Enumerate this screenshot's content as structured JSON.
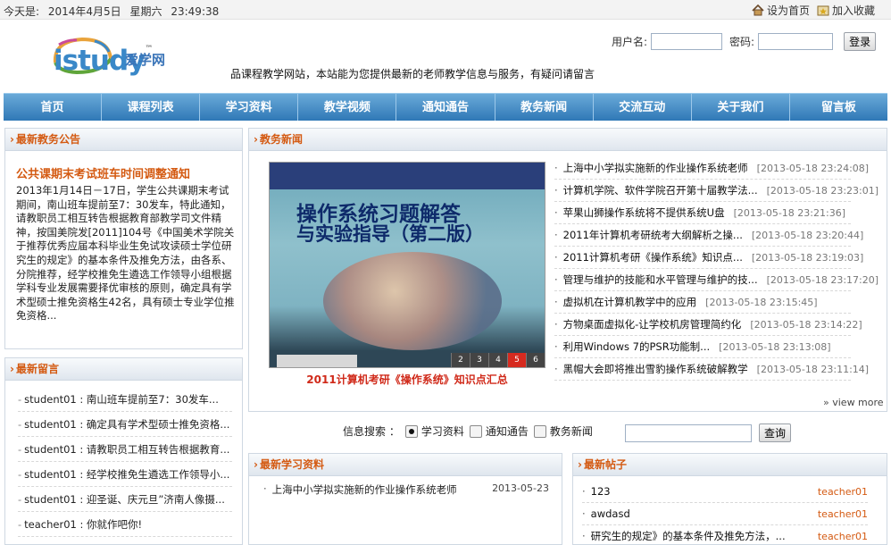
{
  "topbar": {
    "date_label": "今天是:",
    "date": "2014年4月5日",
    "weekday": "星期六",
    "time": "23:49:38",
    "set_home": "设为首页",
    "add_fav": "加入收藏"
  },
  "header": {
    "logo_text": "istudy",
    "logo_tm": "™",
    "logo_cn": "爱学网",
    "slogan": "品课程教学网站，本站能为您提供最新的老师教学信息与服务，有疑问请留言",
    "username_label": "用户名:",
    "password_label": "密码:",
    "login_button": "登录"
  },
  "nav": [
    "首页",
    "课程列表",
    "学习资料",
    "教学视频",
    "通知通告",
    "教务新闻",
    "交流互动",
    "关于我们",
    "留言板"
  ],
  "notice": {
    "heading": "最新教务公告",
    "title": "公共课期末考试班车时间调整通知",
    "body": "2013年1月14日－17日，学生公共课期末考试期间，南山班车提前至7：30发车，特此通知，请教职员工相互转告根据教育部教学司文件精神，按国美院发[2011]104号《中国美术学院关于推荐优秀应届本科毕业生免试攻读硕士学位研究生的规定》的基本条件及推免方法，由各系、分院推荐，经学校推免生遴选工作领导小组根据学科专业发展需要择优审核的原则，确定具有学术型硕士推免资格生42名，具有硕士专业学位推免资格..."
  },
  "messages": {
    "heading": "最新留言",
    "items": [
      "student01 : 南山班车提前至7：30发车...",
      "student01 : 确定具有学术型硕士推免资格...",
      "student01 : 请教职员工相互转告根据教育...",
      "student01 : 经学校推免生遴选工作领导小...",
      "student01 : 迎圣诞、庆元旦”济南人像摄...",
      "teacher01 : 你就作吧你!"
    ]
  },
  "news": {
    "heading": "教务新闻",
    "image_title_1": "操作系统习题解答",
    "image_title_2": "与实验指导（第二版）",
    "image_pages": [
      "2",
      "3",
      "4",
      "5",
      "6"
    ],
    "caption": "2011计算机考研《操作系统》知识点汇总",
    "items": [
      {
        "title": "上海中小学拟实施新的作业操作系统老师",
        "date": "[2013-05-18 23:24:08]"
      },
      {
        "title": "计算机学院、软件学院召开第十届教学法...",
        "date": "[2013-05-18 23:23:01]"
      },
      {
        "title": "苹果山狮操作系统将不提供系统U盘",
        "date": "[2013-05-18 23:21:36]"
      },
      {
        "title": "2011年计算机考研统考大纲解析之操...",
        "date": "[2013-05-18 23:20:44]"
      },
      {
        "title": "2011计算机考研《操作系统》知识点...",
        "date": "[2013-05-18 23:19:03]"
      },
      {
        "title": "管理与维护的技能和水平管理与维护的技...",
        "date": "[2013-05-18 23:17:20]"
      },
      {
        "title": "虚拟机在计算机教学中的应用",
        "date": "[2013-05-18 23:15:45]"
      },
      {
        "title": "方物桌面虚拟化-让学校机房管理简约化",
        "date": "[2013-05-18 23:14:22]"
      },
      {
        "title": "利用Windows 7的PSR功能制...",
        "date": "[2013-05-18 23:13:08]"
      },
      {
        "title": "黑帽大会即将推出雪豹操作系统破解教学",
        "date": "[2013-05-18 23:11:14]"
      }
    ],
    "view_more": "view more"
  },
  "search": {
    "label": "信息搜索 ：",
    "options": [
      "学习资料",
      "通知通告",
      "教务新闻"
    ],
    "selected": "学习资料",
    "button": "查询"
  },
  "study": {
    "heading": "最新学习资料",
    "items": [
      {
        "title": "上海中小学拟实施新的作业操作系统老师",
        "date": "2013-05-23"
      }
    ]
  },
  "posts": {
    "heading": "最新帖子",
    "items": [
      {
        "title": "123",
        "author": "teacher01"
      },
      {
        "title": "awdasd",
        "author": "teacher01"
      },
      {
        "title": "研究生的规定》的基本条件及推免方法，...",
        "author": "teacher01"
      }
    ]
  },
  "colors": {
    "accent_orange": "#d45a12",
    "nav_blue": "#2f78b6",
    "caption_red": "#d02a1a"
  }
}
